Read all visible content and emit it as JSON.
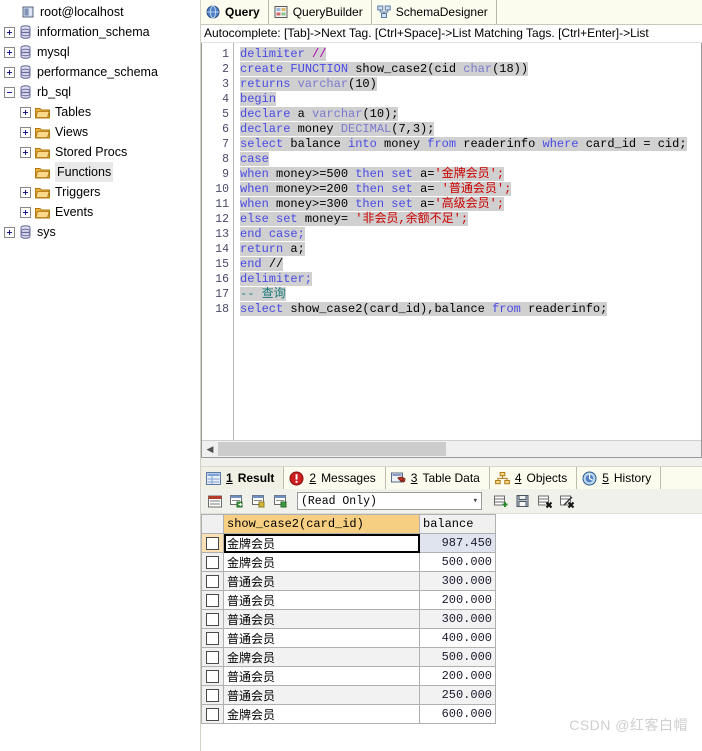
{
  "sidebar": {
    "root": {
      "label": "root@localhost",
      "icon": "server-icon"
    },
    "nodes": [
      {
        "label": "information_schema",
        "icon": "database-icon",
        "indent": 1,
        "expander": "plus"
      },
      {
        "label": "mysql",
        "icon": "database-icon",
        "indent": 1,
        "expander": "plus"
      },
      {
        "label": "performance_schema",
        "icon": "database-icon",
        "indent": 1,
        "expander": "plus"
      },
      {
        "label": "rb_sql",
        "icon": "database-icon",
        "indent": 1,
        "expander": "minus"
      },
      {
        "label": "Tables",
        "icon": "folder-icon",
        "indent": 2,
        "expander": "plus"
      },
      {
        "label": "Views",
        "icon": "folder-icon",
        "indent": 2,
        "expander": "plus"
      },
      {
        "label": "Stored Procs",
        "icon": "folder-icon",
        "indent": 2,
        "expander": "plus"
      },
      {
        "label": "Functions",
        "icon": "folder-icon",
        "indent": 2,
        "expander": "none",
        "selected": true
      },
      {
        "label": "Triggers",
        "icon": "folder-icon",
        "indent": 2,
        "expander": "plus"
      },
      {
        "label": "Events",
        "icon": "folder-icon",
        "indent": 2,
        "expander": "plus"
      },
      {
        "label": "sys",
        "icon": "database-icon",
        "indent": 1,
        "expander": "plus"
      }
    ]
  },
  "tabs": [
    {
      "label": "Query",
      "icon": "globe-icon",
      "active": true
    },
    {
      "label": "QueryBuilder",
      "icon": "query-builder-icon",
      "active": false
    },
    {
      "label": "SchemaDesigner",
      "icon": "schema-designer-icon",
      "active": false
    }
  ],
  "autocomplete_hint": "Autocomplete: [Tab]->Next Tag. [Ctrl+Space]->List Matching Tags. [Ctrl+Enter]->List",
  "editor": {
    "line_numbers": [
      "1",
      "2",
      "3",
      "4",
      "5",
      "6",
      "7",
      "8",
      "9",
      "10",
      "11",
      "12",
      "13",
      "14",
      "15",
      "16",
      "17",
      "18"
    ],
    "lines": [
      {
        "n": 1,
        "tokens": [
          {
            "t": "delimiter ",
            "c": "kw"
          },
          {
            "t": "//",
            "c": "fn"
          }
        ]
      },
      {
        "n": 2,
        "tokens": [
          {
            "t": "create ",
            "c": "kw"
          },
          {
            "t": "FUNCTION ",
            "c": "kw"
          },
          {
            "t": "show_case2",
            "c": "txt"
          },
          {
            "t": "(cid ",
            "c": "txt"
          },
          {
            "t": "char",
            "c": "typ"
          },
          {
            "t": "(18))",
            "c": "txt"
          }
        ]
      },
      {
        "n": 3,
        "tokens": [
          {
            "t": "returns ",
            "c": "kw"
          },
          {
            "t": "varchar",
            "c": "typ"
          },
          {
            "t": "(10)",
            "c": "txt"
          }
        ]
      },
      {
        "n": 4,
        "tokens": [
          {
            "t": "begin",
            "c": "kw"
          }
        ]
      },
      {
        "n": 5,
        "tokens": [
          {
            "t": "declare ",
            "c": "kw"
          },
          {
            "t": "a ",
            "c": "txt"
          },
          {
            "t": "varchar",
            "c": "typ"
          },
          {
            "t": "(10);",
            "c": "txt"
          }
        ]
      },
      {
        "n": 6,
        "tokens": [
          {
            "t": "declare ",
            "c": "kw"
          },
          {
            "t": "money ",
            "c": "txt"
          },
          {
            "t": "DECIMAL",
            "c": "typ"
          },
          {
            "t": "(7,3);",
            "c": "txt"
          }
        ]
      },
      {
        "n": 7,
        "tokens": [
          {
            "t": "select ",
            "c": "kw"
          },
          {
            "t": "balance ",
            "c": "txt"
          },
          {
            "t": "into ",
            "c": "kw"
          },
          {
            "t": "money ",
            "c": "txt"
          },
          {
            "t": "from ",
            "c": "kw"
          },
          {
            "t": "readerinfo ",
            "c": "txt"
          },
          {
            "t": "where ",
            "c": "kw"
          },
          {
            "t": "card_id = cid;",
            "c": "txt"
          }
        ]
      },
      {
        "n": 8,
        "tokens": [
          {
            "t": "case",
            "c": "kw"
          }
        ]
      },
      {
        "n": 9,
        "tokens": [
          {
            "t": "when ",
            "c": "kw"
          },
          {
            "t": "money>=500 ",
            "c": "txt"
          },
          {
            "t": "then ",
            "c": "kw"
          },
          {
            "t": "set ",
            "c": "kw"
          },
          {
            "t": "a=",
            "c": "txt"
          },
          {
            "t": "'金牌会员';",
            "c": "str"
          }
        ]
      },
      {
        "n": 10,
        "tokens": [
          {
            "t": "when ",
            "c": "kw"
          },
          {
            "t": "money>=200 ",
            "c": "txt"
          },
          {
            "t": "then ",
            "c": "kw"
          },
          {
            "t": "set ",
            "c": "kw"
          },
          {
            "t": "a= ",
            "c": "txt"
          },
          {
            "t": "'普通会员';",
            "c": "str"
          }
        ]
      },
      {
        "n": 11,
        "tokens": [
          {
            "t": "when ",
            "c": "kw"
          },
          {
            "t": "money>=300 ",
            "c": "txt"
          },
          {
            "t": "then ",
            "c": "kw"
          },
          {
            "t": "set ",
            "c": "kw"
          },
          {
            "t": "a=",
            "c": "txt"
          },
          {
            "t": "'高级会员';",
            "c": "str"
          }
        ]
      },
      {
        "n": 12,
        "tokens": [
          {
            "t": "else ",
            "c": "kw"
          },
          {
            "t": "set ",
            "c": "kw"
          },
          {
            "t": "money= ",
            "c": "txt"
          },
          {
            "t": "'非会员,余额不足';",
            "c": "str"
          }
        ]
      },
      {
        "n": 13,
        "tokens": [
          {
            "t": "end ",
            "c": "kw"
          },
          {
            "t": "case;",
            "c": "kw"
          }
        ]
      },
      {
        "n": 14,
        "tokens": [
          {
            "t": "return ",
            "c": "kw"
          },
          {
            "t": "a;",
            "c": "txt"
          }
        ]
      },
      {
        "n": 15,
        "tokens": [
          {
            "t": "end ",
            "c": "kw"
          },
          {
            "t": "//",
            "c": "txt"
          }
        ]
      },
      {
        "n": 16,
        "tokens": [
          {
            "t": "delimiter;",
            "c": "kw"
          }
        ]
      },
      {
        "n": 17,
        "tokens": [
          {
            "t": "-- 查询",
            "c": "cmt"
          }
        ]
      },
      {
        "n": 18,
        "tokens": [
          {
            "t": "select ",
            "c": "kw"
          },
          {
            "t": "show_case2(card_id),balance ",
            "c": "txt"
          },
          {
            "t": "from ",
            "c": "kw"
          },
          {
            "t": "readerinfo;",
            "c": "txt"
          }
        ]
      }
    ]
  },
  "result_tabs": [
    {
      "num": "1",
      "label": "Result",
      "icon": "grid-icon",
      "active": true
    },
    {
      "num": "2",
      "label": "Messages",
      "icon": "error-icon",
      "active": false
    },
    {
      "num": "3",
      "label": "Table Data",
      "icon": "table-data-icon",
      "active": false
    },
    {
      "num": "4",
      "label": "Objects",
      "icon": "objects-icon",
      "active": false
    },
    {
      "num": "5",
      "label": "History",
      "icon": "history-icon",
      "active": false
    }
  ],
  "result_toolbar": {
    "buttons": [
      {
        "name": "grid-view-button",
        "icon": "grid-red-icon"
      },
      {
        "name": "export-grid-button",
        "icon": "grid-export-icon"
      },
      {
        "name": "import-grid-button",
        "icon": "grid-import-icon"
      },
      {
        "name": "refresh-grid-button",
        "icon": "grid-refresh-icon"
      }
    ],
    "mode_select": {
      "value": "(Read Only)",
      "options": [
        "(Read Only)"
      ]
    },
    "right_buttons": [
      {
        "name": "insert-row-button",
        "icon": "row-add-icon"
      },
      {
        "name": "save-changes-button",
        "icon": "save-icon"
      },
      {
        "name": "delete-row-button",
        "icon": "row-delete-icon"
      },
      {
        "name": "cancel-edit-button",
        "icon": "row-cancel-icon"
      }
    ]
  },
  "grid": {
    "columns": [
      "show_case2(card_id)",
      "balance"
    ],
    "rows": [
      {
        "c0": "金牌会员",
        "c1": "987.450",
        "current": true
      },
      {
        "c0": "金牌会员",
        "c1": "500.000"
      },
      {
        "c0": "普通会员",
        "c1": "300.000"
      },
      {
        "c0": "普通会员",
        "c1": "200.000"
      },
      {
        "c0": "普通会员",
        "c1": "300.000"
      },
      {
        "c0": "普通会员",
        "c1": "400.000"
      },
      {
        "c0": "金牌会员",
        "c1": "500.000"
      },
      {
        "c0": "普通会员",
        "c1": "200.000"
      },
      {
        "c0": "普通会员",
        "c1": "250.000"
      },
      {
        "c0": "金牌会员",
        "c1": "600.000"
      }
    ]
  },
  "watermark": "CSDN @红客白帽"
}
